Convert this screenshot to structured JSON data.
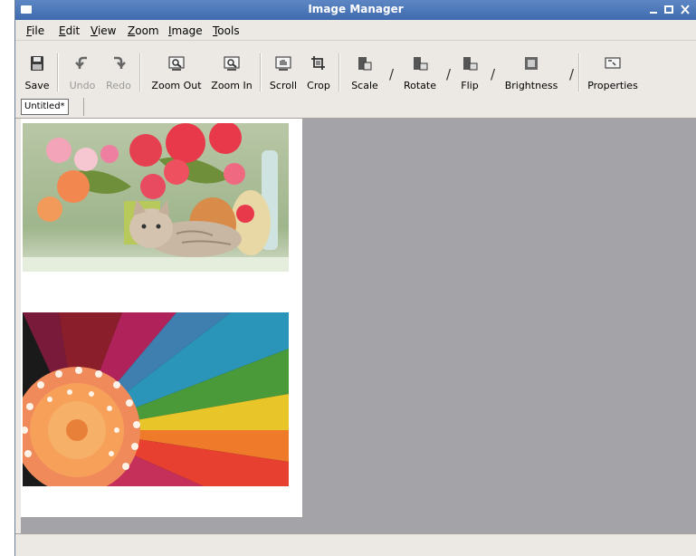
{
  "window": {
    "title": "Image Manager",
    "controls": [
      "minimize",
      "maximize",
      "close"
    ]
  },
  "menu": [
    {
      "label": "File",
      "mnemonic": "F",
      "rest": "ile"
    },
    {
      "label": "Edit",
      "mnemonic": "E",
      "rest": "dit"
    },
    {
      "label": "View",
      "mnemonic": "V",
      "rest": "iew"
    },
    {
      "label": "Zoom",
      "mnemonic": "Z",
      "rest": "oom"
    },
    {
      "label": "Image",
      "mnemonic": "I",
      "rest": "mage"
    },
    {
      "label": "Tools",
      "mnemonic": "T",
      "rest": "ools"
    }
  ],
  "toolbar": {
    "save": "Save",
    "undo": "Undo",
    "redo": "Redo",
    "zoom_out": "Zoom Out",
    "zoom_in": "Zoom In",
    "scroll": "Scroll",
    "crop": "Crop",
    "scale": "Scale",
    "rotate": "Rotate",
    "flip": "Flip",
    "brightness": "Brightness",
    "properties": "Properties",
    "undo_enabled": false,
    "redo_enabled": false
  },
  "tabs": [
    {
      "label": "Untitled*",
      "active": true
    }
  ],
  "document": {
    "images": [
      "kitten-with-flowers-photo",
      "colorful-flower-macro-photo"
    ]
  },
  "colors": {
    "titlebar": "#4a78bb",
    "canvas_bg": "#a4a3a7",
    "window_bg": "#ece9e4"
  }
}
